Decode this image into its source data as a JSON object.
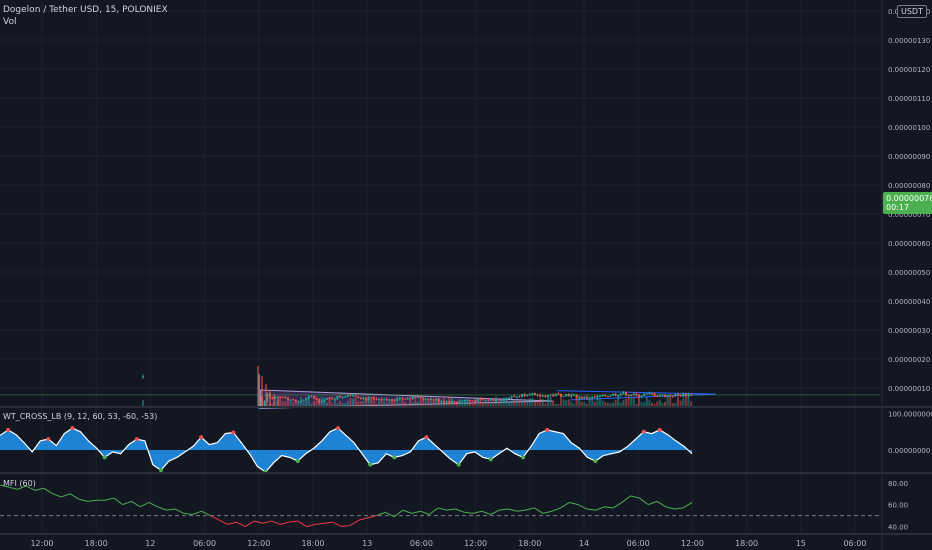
{
  "header": {
    "symbol_line": "Dogelon / Tether USD, 15, POLONIEX",
    "vol_label": "Vol",
    "wt_label": "WT_CROSS_LB (9, 12, 60, 53, -60, -53)",
    "mfi_label": "MFI (60)"
  },
  "currency_badge": "USDT",
  "last_price": {
    "value": "0.00000076",
    "countdown": "00:17"
  },
  "colors": {
    "background": "#131722",
    "up": "#26a69a",
    "down": "#ef5350",
    "wave": "#2196f3",
    "triangle_fill": "#7e57c2",
    "wedge_line": "#2962ff",
    "mfi_line": "#4caf50",
    "badge_green": "#4caf50"
  },
  "chart_data": [
    {
      "type": "candlestick",
      "y_ticks": [
        "0.00000010",
        "0.00000020",
        "0.00000030",
        "0.00000040",
        "0.00000050",
        "0.00000060",
        "0.00000070",
        "0.00000080",
        "0.00000090",
        "0.00000100",
        "0.00000110",
        "0.00000120",
        "0.00000130",
        "0.00000140"
      ],
      "x_ticks": [
        "12:00",
        "18:00",
        "12",
        "06:00",
        "12:00",
        "18:00",
        "13",
        "06:00",
        "12:00",
        "18:00",
        "14",
        "06:00",
        "12:00",
        "18:00",
        "15",
        "06:00"
      ],
      "ylim": [
        5e-08,
        1.45e-06
      ],
      "price_path": [
        [
          0,
          1.35e-07
        ],
        [
          0.5,
          1.35e-07
        ],
        [
          1,
          1.45e-07
        ],
        [
          1.05,
          3e-08
        ],
        [
          1.1,
          8.5e-08
        ],
        [
          1.15,
          6e-08
        ],
        [
          1.3,
          7e-08
        ],
        [
          1.45,
          5e-08
        ],
        [
          1.6,
          7e-08
        ],
        [
          1.7,
          5.5e-08
        ],
        [
          1.9,
          6.8e-08
        ],
        [
          2.05,
          8e-08
        ],
        [
          2.2,
          6.5e-08
        ],
        [
          2.4,
          5.5e-08
        ],
        [
          2.6,
          6.5e-08
        ],
        [
          2.8,
          6.8e-08
        ],
        [
          3.0,
          6e-08
        ],
        [
          3.2,
          5.2e-08
        ],
        [
          3.35,
          5.8e-08
        ],
        [
          3.5,
          5.7e-08
        ],
        [
          3.7,
          6e-08
        ],
        [
          3.95,
          7.2e-08
        ],
        [
          4.1,
          8.5e-08
        ],
        [
          4.15,
          7e-08
        ],
        [
          4.3,
          7.5e-08
        ],
        [
          4.5,
          7.8e-08
        ],
        [
          4.7,
          6.6e-08
        ],
        [
          4.85,
          6.8e-08
        ],
        [
          5.0,
          7.6e-08
        ],
        [
          5.15,
          8.2e-08
        ],
        [
          5.3,
          7.4e-08
        ],
        [
          5.45,
          7.9e-08
        ],
        [
          5.6,
          7.4e-08
        ],
        [
          5.8,
          7.6e-08
        ],
        [
          5.95,
          7.7e-08
        ]
      ],
      "triangle": {
        "apex_price": 5.5e-08,
        "top_price": 9.3e-08,
        "bottom_price": 3e-08
      },
      "wedge": {
        "upper": [
          9.1e-08,
          7.9e-08
        ],
        "lower": [
          5.9e-08,
          7.9e-08
        ]
      },
      "last_value": 7.6e-08
    },
    {
      "type": "area",
      "title": "WT_CROSS_LB (9, 12, 60, 53, -60, -53)",
      "y_ticks": [
        "100.00000000",
        "0.00000000"
      ],
      "ylim": [
        -60,
        115
      ],
      "values": [
        40,
        55,
        42,
        20,
        -5,
        25,
        30,
        12,
        45,
        60,
        50,
        25,
        5,
        -20,
        -5,
        -10,
        15,
        30,
        25,
        -40,
        -55,
        -30,
        -20,
        -5,
        10,
        35,
        15,
        20,
        45,
        48,
        20,
        -10,
        -45,
        -60,
        -35,
        -15,
        -20,
        -30,
        -10,
        5,
        25,
        50,
        60,
        40,
        20,
        -10,
        -40,
        -35,
        -10,
        -20,
        -15,
        -5,
        25,
        35,
        15,
        -5,
        -25,
        -40,
        -10,
        -5,
        -20,
        -25,
        -10,
        5,
        -10,
        -20,
        10,
        45,
        55,
        50,
        45,
        20,
        5,
        -20,
        -30,
        -15,
        -10,
        -5,
        10,
        30,
        50,
        45,
        55,
        42,
        25,
        10,
        -10
      ]
    },
    {
      "type": "line",
      "title": "MFI (60)",
      "y_ticks": [
        "80.00",
        "60.00",
        "40.00"
      ],
      "ylim": [
        35,
        88
      ],
      "dashed_level": 50,
      "values": [
        78,
        76,
        74,
        77,
        73,
        75,
        70,
        67,
        70,
        65,
        63,
        64,
        64,
        66,
        60,
        63,
        58,
        62,
        58,
        55,
        56,
        52,
        51,
        54,
        50,
        46,
        42,
        44,
        40,
        45,
        43,
        45,
        42,
        44,
        45,
        40,
        42,
        43,
        44,
        40,
        41,
        46,
        48,
        50,
        53,
        49,
        55,
        52,
        54,
        51,
        57,
        55,
        56,
        53,
        52,
        54,
        51,
        55,
        56,
        54,
        55,
        57,
        52,
        54,
        57,
        62,
        60,
        56,
        55,
        58,
        57,
        62,
        68,
        66,
        60,
        63,
        58,
        56,
        57,
        62
      ]
    }
  ]
}
